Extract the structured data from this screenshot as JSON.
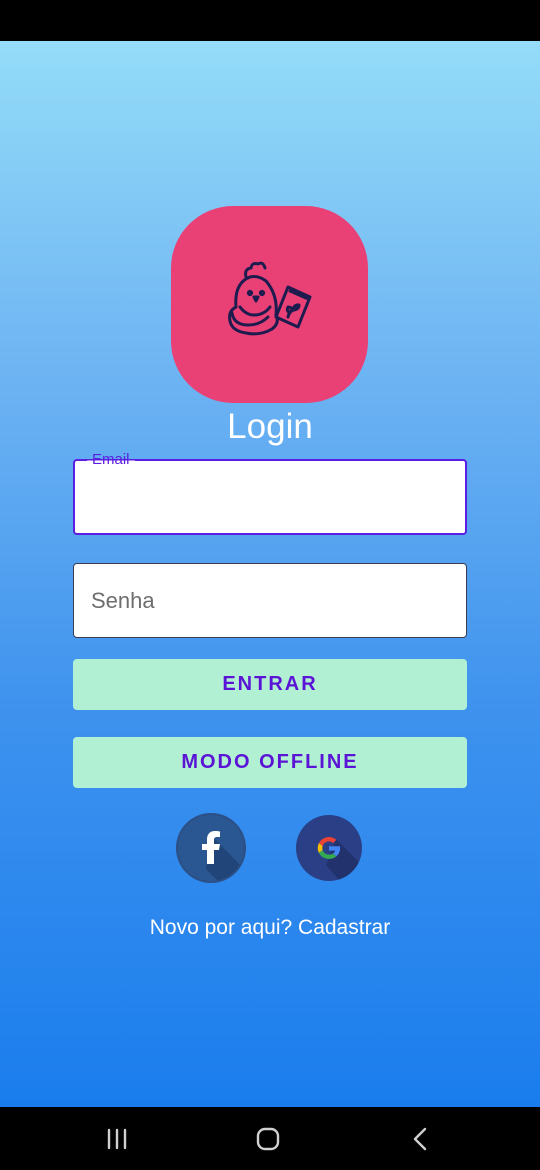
{
  "brand": {
    "logo_bg": "#e94175",
    "accent": "#5b14d6",
    "button_bg": "#b2f0d3"
  },
  "login": {
    "title": "Login",
    "email_label": "Email",
    "email_value": "",
    "password_placeholder": "Senha",
    "enter_button": "ENTRAR",
    "offline_button": "MODO OFFLINE",
    "signup_link": "Novo por aqui? Cadastrar"
  },
  "social": {
    "facebook_icon": "facebook-icon",
    "google_icon": "google-icon"
  },
  "navigation": {
    "recent_icon": "recent-apps-icon",
    "home_icon": "home-icon",
    "back_icon": "back-icon"
  }
}
